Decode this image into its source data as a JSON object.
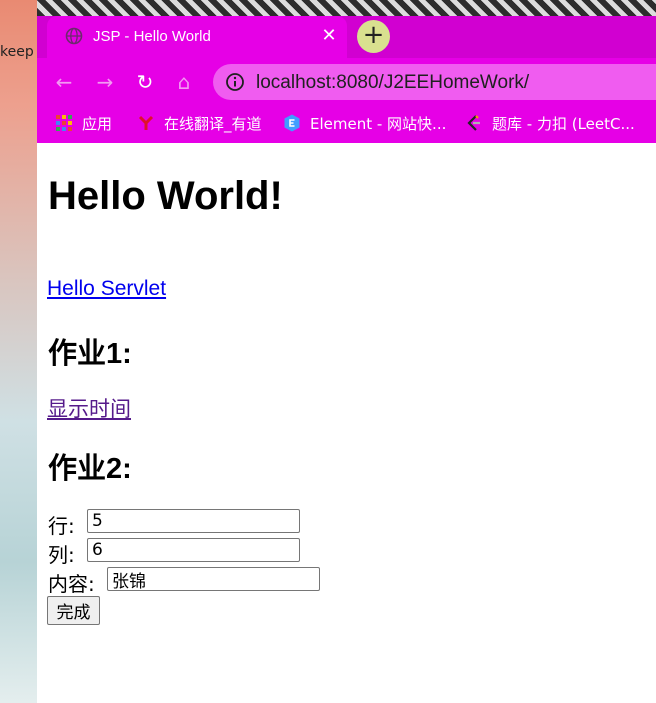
{
  "desktop": {
    "icon_label": "keep"
  },
  "browser": {
    "tab": {
      "title": "JSP - Hello World",
      "close": "✕"
    },
    "new_tab": "+",
    "nav": {
      "back": "←",
      "forward": "→",
      "reload": "↻",
      "home": "⌂"
    },
    "url": "localhost:8080/J2EEHomeWork/",
    "bookmarks": [
      {
        "label": "应用",
        "icon": "apps-grid-icon"
      },
      {
        "label": "在线翻译_有道",
        "icon": "youdao-icon"
      },
      {
        "label": "Element - 网站快...",
        "icon": "element-icon"
      },
      {
        "label": "题库 - 力扣 (LeetC...",
        "icon": "leetcode-icon"
      }
    ],
    "accent_color": "#e600e6"
  },
  "page": {
    "heading": "Hello World!",
    "servlet_link": "Hello Servlet",
    "hw1": {
      "heading": "作业1:",
      "link": "显示时间"
    },
    "hw2": {
      "heading": "作业2:",
      "rows_label": "行:",
      "rows_value": "5",
      "cols_label": "列:",
      "cols_value": "6",
      "content_label": "内容:",
      "content_value": "张锦",
      "submit_label": "完成"
    }
  }
}
